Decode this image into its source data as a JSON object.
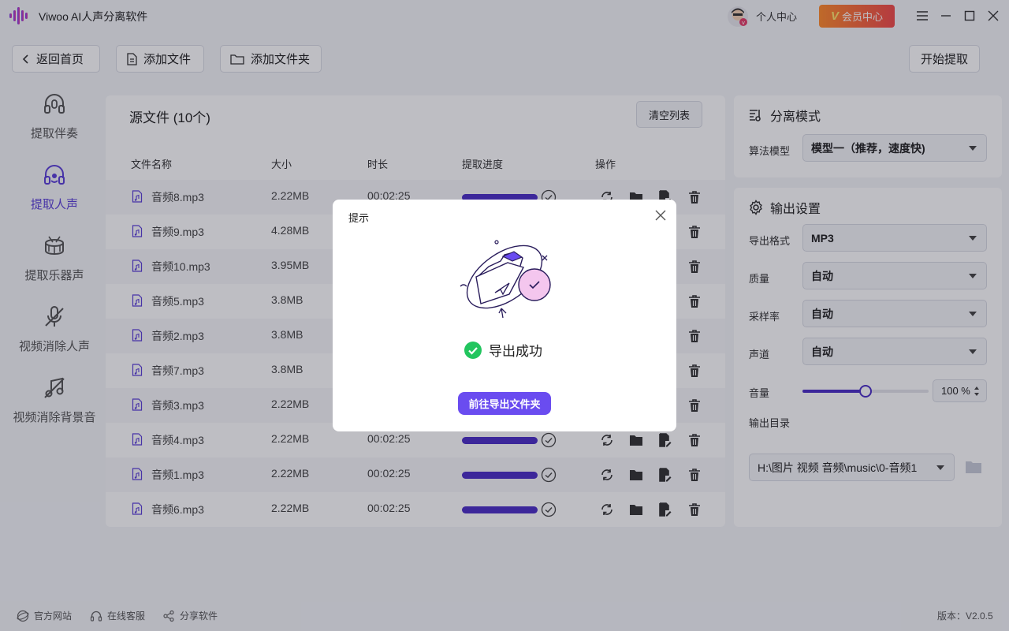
{
  "app": {
    "title": "Viwoo AI人声分离软件"
  },
  "header": {
    "user_center": "个人中心",
    "vip_label": "会员中心",
    "vip_mark": "V"
  },
  "toolbar": {
    "back": "返回首页",
    "add_file": "添加文件",
    "add_folder": "添加文件夹",
    "start": "开始提取"
  },
  "sidebar": {
    "items": [
      {
        "label": "提取伴奏",
        "icon": "headphones-icon",
        "active": false
      },
      {
        "label": "提取人声",
        "icon": "headset-icon",
        "active": true
      },
      {
        "label": "提取乐器声",
        "icon": "drum-icon",
        "active": false
      },
      {
        "label": "视频消除人声",
        "icon": "mute-mic-icon",
        "active": false
      },
      {
        "label": "视频消除背景音",
        "icon": "mute-music-icon",
        "active": false
      }
    ]
  },
  "list": {
    "title": "源文件 (10个)",
    "clear_label": "清空列表",
    "columns": [
      "文件名称",
      "大小",
      "时长",
      "提取进度",
      "操作"
    ],
    "rows": [
      {
        "name": "音频8.mp3",
        "size": "2.22MB",
        "duration": "00:02:25",
        "progress": 1.0
      },
      {
        "name": "音频9.mp3",
        "size": "4.28MB",
        "duration": "",
        "progress": 1.0
      },
      {
        "name": "音频10.mp3",
        "size": "3.95MB",
        "duration": "",
        "progress": 1.0
      },
      {
        "name": "音频5.mp3",
        "size": "3.8MB",
        "duration": "",
        "progress": 1.0
      },
      {
        "name": "音频2.mp3",
        "size": "3.8MB",
        "duration": "",
        "progress": 1.0
      },
      {
        "name": "音频7.mp3",
        "size": "3.8MB",
        "duration": "",
        "progress": 1.0
      },
      {
        "name": "音频3.mp3",
        "size": "2.22MB",
        "duration": "",
        "progress": 1.0
      },
      {
        "name": "音频4.mp3",
        "size": "2.22MB",
        "duration": "00:02:25",
        "progress": 1.0
      },
      {
        "name": "音频1.mp3",
        "size": "2.22MB",
        "duration": "00:02:25",
        "progress": 1.0
      },
      {
        "name": "音频6.mp3",
        "size": "2.22MB",
        "duration": "00:02:25",
        "progress": 1.0
      }
    ]
  },
  "separation": {
    "title": "分离模式",
    "algo_label": "算法模型",
    "algo_value": "模型一（推荐，速度快)"
  },
  "output": {
    "title": "输出设置",
    "format_label": "导出格式",
    "format_value": "MP3",
    "quality_label": "质量",
    "quality_value": "自动",
    "samplerate_label": "采样率",
    "samplerate_value": "自动",
    "channel_label": "声道",
    "channel_value": "自动",
    "volume_label": "音量",
    "volume_value": "100 %",
    "volume_level": 0.5,
    "dir_label": "输出目录",
    "dir_value": "H:\\图片 视频 音频\\music\\0-音频1"
  },
  "footer": {
    "website": "官方网站",
    "support": "在线客服",
    "share": "分享软件",
    "version": "版本：V2.0.5"
  },
  "dialog": {
    "title": "提示",
    "message": "导出成功",
    "button": "前往导出文件夹"
  },
  "colors": {
    "accent": "#4b2fc7",
    "success": "#22c55e",
    "vip_start": "#ff8a2b",
    "vip_end": "#f24a4a",
    "dialog_button": "#6a4cf0"
  }
}
